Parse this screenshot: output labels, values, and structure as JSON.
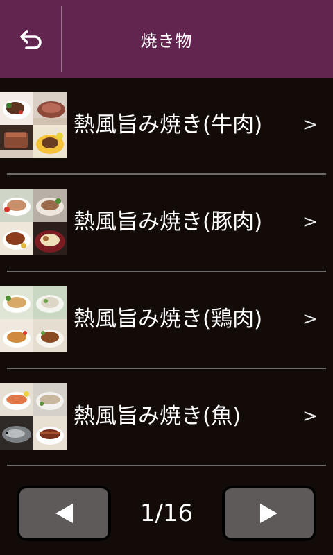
{
  "header": {
    "title": "焼き物",
    "back_icon": "back-arrow-icon",
    "background": "#62254f"
  },
  "items": [
    {
      "label": "熱風旨み焼き(牛肉)",
      "chevron": ">",
      "thumb": "beef-dishes-image"
    },
    {
      "label": "熱風旨み焼き(豚肉)",
      "chevron": ">",
      "thumb": "pork-dishes-image"
    },
    {
      "label": "熱風旨み焼き(鶏肉)",
      "chevron": ">",
      "thumb": "chicken-dishes-image"
    },
    {
      "label": "熱風旨み焼き(魚)",
      "chevron": ">",
      "thumb": "fish-dishes-image"
    }
  ],
  "pager": {
    "indicator": "1/16",
    "prev_icon": "left-triangle-icon",
    "next_icon": "right-triangle-icon"
  }
}
